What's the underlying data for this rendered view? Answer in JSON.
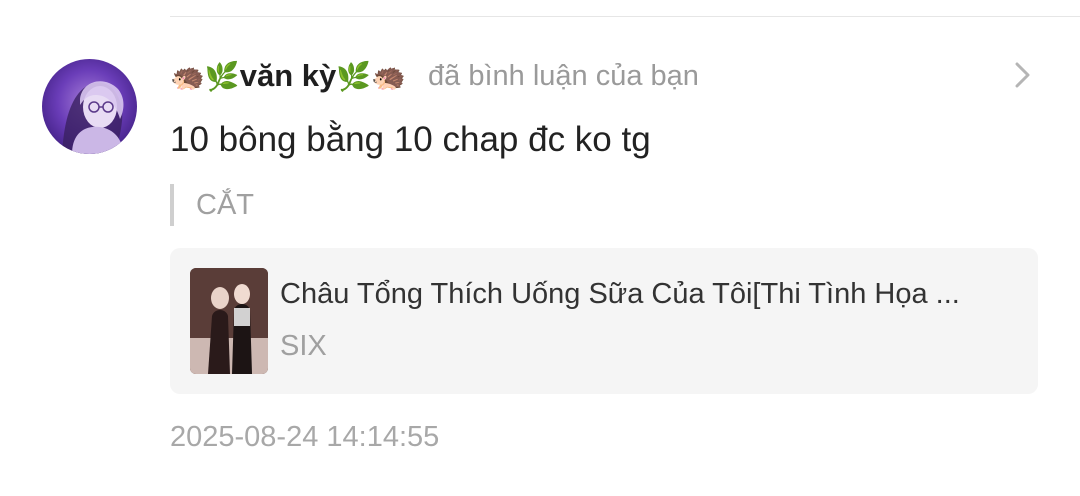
{
  "notification": {
    "user": {
      "prefix_emojis": [
        "🦔",
        "🌿"
      ],
      "name": "văn kỳ",
      "suffix_emojis": [
        "🌿",
        "🦔"
      ]
    },
    "action_text": "đã bình luận của bạn",
    "comment": "10 bông bằng 10 chap đc ko tg",
    "quoted_text": "CẮT",
    "work": {
      "title": "Châu Tổng Thích Uống Sữa Của Tôi[Thi Tình Họa ...",
      "author": "SIX"
    },
    "timestamp": "2025-08-24 14:14:55"
  },
  "icons": {
    "avatar": "user-avatar-icon",
    "chevron": "chevron-right-icon",
    "thumbnail": "work-cover-thumbnail"
  },
  "colors": {
    "username": "#1f1f1f",
    "secondary_text": "#9a9a9a",
    "card_background": "#f5f5f5",
    "quote_bar": "#cfcfcf"
  }
}
